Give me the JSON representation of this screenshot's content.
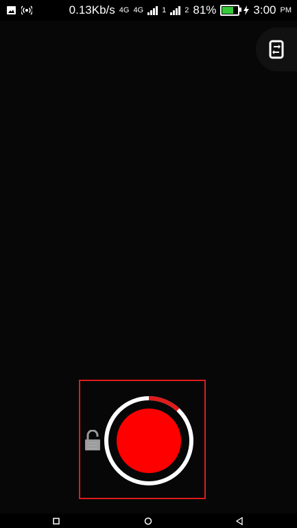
{
  "status_bar": {
    "network_speed": "0.13Kb/s",
    "network_type_1": "4G",
    "network_type_2": "4G",
    "sim_1_label": "1",
    "sim_2_label": "2",
    "battery_percent": "81%",
    "battery_level": 0.81,
    "time": "3:00",
    "ampm": "PM",
    "icons": [
      "image-icon",
      "hotspot-icon",
      "signal-icon",
      "battery-icon",
      "charging-icon"
    ]
  },
  "camera": {
    "flip_icon": "camera-switch-icon",
    "recording_progress": 0.12,
    "lock_icon": "unlock-icon"
  },
  "colors": {
    "background": "#070707",
    "record": "#ff0000",
    "progress": "#e01b1b",
    "ring": "#ffffff",
    "battery": "#35c83a",
    "lock": "#9a9a9a"
  },
  "nav_bar": {
    "icons": [
      "recents-icon",
      "home-icon",
      "back-icon"
    ]
  }
}
